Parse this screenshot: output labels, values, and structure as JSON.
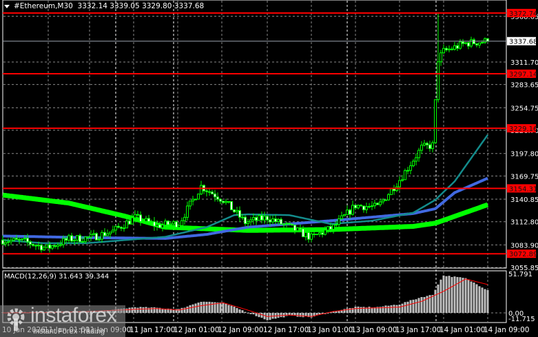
{
  "header": {
    "symbol": "#Ethereum,M30",
    "ohlc": "3332.14 3339.05 3329.80 3337.68"
  },
  "macd_header": "MACD(12,26,9) 31.643 39.344",
  "watermark": {
    "brand": "instaforex",
    "tagline": "Instant Forex Trading"
  },
  "colors": {
    "background": "#000000",
    "candle": "#00ff00",
    "grid": "#8a8a8a",
    "level_line": "#ff0000",
    "ma_slow": "#00ff00",
    "ma_mid": "#4169e1",
    "ma_fast": "#138c8c",
    "macd_hist": "#c0c0c0",
    "macd_signal": "#ff0000"
  },
  "chart_data": [
    {
      "type": "candlestick",
      "timeframe": "M30",
      "price_axis_ticks": [
        "3368.65",
        "3337.68",
        "3311.70",
        "3283.65",
        "3254.75",
        "3226.70",
        "3197.80",
        "3169.75",
        "3140.85",
        "3112.80",
        "3083.90",
        "3055.85"
      ],
      "ylim": [
        3055.85,
        3372.74
      ],
      "time_axis_ticks": [
        "10 Jan 2026",
        "11 Jan 01:00",
        "11 Jan 09:00",
        "11 Jan 17:00",
        "12 Jan 01:00",
        "12 Jan 09:00",
        "12 Jan 17:00",
        "13 Jan 01:00",
        "13 Jan 09:00",
        "13 Jan 17:00",
        "14 Jan 01:00",
        "14 Jan 09:00"
      ],
      "current_price": "3337.68",
      "levels": [
        "3372.74",
        "3297.14",
        "3229.16",
        "3154.31",
        "3072.89"
      ],
      "grid": true,
      "close_approx": [
        [
          "10 Jan 17:00",
          3090
        ],
        [
          "10 Jan 21:00",
          3088
        ],
        [
          "11 Jan 01:00",
          3080
        ],
        [
          "11 Jan 05:00",
          3091
        ],
        [
          "11 Jan 09:00",
          3093
        ],
        [
          "11 Jan 13:00",
          3101
        ],
        [
          "11 Jan 17:00",
          3118
        ],
        [
          "11 Jan 21:00",
          3108
        ],
        [
          "12 Jan 01:00",
          3111
        ],
        [
          "12 Jan 05:00",
          3157
        ],
        [
          "12 Jan 09:00",
          3140
        ],
        [
          "12 Jan 13:00",
          3112
        ],
        [
          "12 Jan 17:00",
          3118
        ],
        [
          "12 Jan 21:00",
          3106
        ],
        [
          "13 Jan 01:00",
          3093
        ],
        [
          "13 Jan 05:00",
          3106
        ],
        [
          "13 Jan 09:00",
          3133
        ],
        [
          "13 Jan 13:00",
          3131
        ],
        [
          "13 Jan 17:00",
          3165
        ],
        [
          "13 Jan 21:00",
          3205
        ],
        [
          "13 Jan 23:00",
          3208
        ],
        [
          "14 Jan 00:00",
          3315
        ],
        [
          "14 Jan 01:00",
          3325
        ],
        [
          "14 Jan 05:00",
          3335
        ],
        [
          "14 Jan 09:00",
          3337.68
        ]
      ],
      "moving_averages": [
        {
          "color": "#00ff00",
          "points": [
            [
              "10 Jan 17:00",
              3146
            ],
            [
              "11 Jan 05:00",
              3136
            ],
            [
              "11 Jan 15:00",
              3120
            ],
            [
              "11 Jan 22:30",
              3106
            ],
            [
              "12 Jan 13:30",
              3102
            ],
            [
              "13 Jan 04:30",
              3103
            ],
            [
              "13 Jan 19:30",
              3107
            ],
            [
              "13 Jan 23:30",
              3111
            ],
            [
              "14 Jan 09:00",
              3134
            ]
          ]
        },
        {
          "color": "#4169e1",
          "points": [
            [
              "10 Jan 17:00",
              3095
            ],
            [
              "11 Jan 08:00",
              3093
            ],
            [
              "11 Jan 22:30",
              3092
            ],
            [
              "12 Jan 06:00",
              3097
            ],
            [
              "12 Jan 13:30",
              3106
            ],
            [
              "13 Jan 04:30",
              3114
            ],
            [
              "13 Jan 19:30",
              3123
            ],
            [
              "13 Jan 23:30",
              3129
            ],
            [
              "14 Jan 03:00",
              3149
            ],
            [
              "14 Jan 09:00",
              3167
            ]
          ]
        },
        {
          "color": "#138c8c",
          "points": [
            [
              "10 Jan 17:00",
              3090
            ],
            [
              "11 Jan 00:30",
              3086
            ],
            [
              "11 Jan 08:00",
              3086
            ],
            [
              "11 Jan 22:30",
              3094
            ],
            [
              "12 Jan 06:00",
              3106
            ],
            [
              "12 Jan 11:00",
              3121
            ],
            [
              "12 Jan 13:30",
              3122
            ],
            [
              "12 Jan 21:00",
              3121
            ],
            [
              "13 Jan 04:30",
              3110
            ],
            [
              "13 Jan 12:00",
              3114
            ],
            [
              "13 Jan 19:30",
              3124
            ],
            [
              "13 Jan 23:30",
              3140
            ],
            [
              "14 Jan 03:00",
              3163
            ],
            [
              "14 Jan 09:00",
              3221
            ]
          ]
        }
      ]
    },
    {
      "type": "bar",
      "name": "MACD(12,26,9)",
      "axis_ticks": [
        "51.791",
        "0.00",
        "-11.715"
      ],
      "ylim": [
        -11.715,
        51.791
      ],
      "histogram": [
        [
          "10 Jan 17:00",
          1
        ],
        [
          "10 Jan 21:00",
          1
        ],
        [
          "11 Jan 01:00",
          1
        ],
        [
          "11 Jan 05:00",
          2
        ],
        [
          "11 Jan 09:00",
          2
        ],
        [
          "11 Jan 13:00",
          4
        ],
        [
          "11 Jan 17:00",
          8
        ],
        [
          "11 Jan 21:00",
          7
        ],
        [
          "12 Jan 01:00",
          5
        ],
        [
          "12 Jan 05:00",
          16
        ],
        [
          "12 Jan 09:00",
          14
        ],
        [
          "12 Jan 13:00",
          2
        ],
        [
          "12 Jan 17:00",
          -10
        ],
        [
          "12 Jan 21:00",
          -4
        ],
        [
          "13 Jan 01:00",
          -6
        ],
        [
          "13 Jan 05:00",
          2
        ],
        [
          "13 Jan 09:00",
          8
        ],
        [
          "13 Jan 13:00",
          8
        ],
        [
          "13 Jan 17:00",
          12
        ],
        [
          "13 Jan 21:00",
          22
        ],
        [
          "13 Jan 23:00",
          25
        ],
        [
          "14 Jan 00:00",
          40
        ],
        [
          "14 Jan 01:00",
          52
        ],
        [
          "14 Jan 05:00",
          48
        ],
        [
          "14 Jan 09:00",
          31.643
        ]
      ],
      "signal": [
        [
          "10 Jan 17:00",
          0
        ],
        [
          "11 Jan 01:00",
          0.5
        ],
        [
          "11 Jan 09:00",
          2
        ],
        [
          "11 Jan 17:00",
          5
        ],
        [
          "11 Jan 21:00",
          6
        ],
        [
          "12 Jan 01:00",
          4
        ],
        [
          "12 Jan 05:00",
          10
        ],
        [
          "12 Jan 09:00",
          14
        ],
        [
          "12 Jan 13:00",
          5
        ],
        [
          "12 Jan 17:00",
          -5
        ],
        [
          "12 Jan 21:00",
          -3
        ],
        [
          "13 Jan 01:00",
          -5
        ],
        [
          "13 Jan 05:00",
          2
        ],
        [
          "13 Jan 09:00",
          6
        ],
        [
          "13 Jan 13:00",
          7
        ],
        [
          "13 Jan 17:00",
          8
        ],
        [
          "13 Jan 21:00",
          16
        ],
        [
          "14 Jan 01:00",
          30
        ],
        [
          "14 Jan 05:00",
          47
        ],
        [
          "14 Jan 09:00",
          39.344
        ]
      ]
    }
  ]
}
